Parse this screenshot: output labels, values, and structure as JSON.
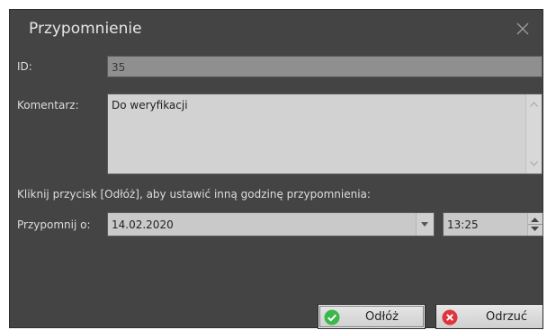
{
  "dialog": {
    "title": "Przypomnienie",
    "id_label": "ID:",
    "id_value": "35",
    "comment_label": "Komentarz:",
    "comment_value": "Do weryfikacji",
    "instruction": "Kliknij przycisk [Odłóż], aby ustawić inną godzinę przypomnienia:",
    "remind_label": "Przypomnij o:",
    "date_value": "14.02.2020",
    "time_value": "13:25",
    "postpone_label": "Odłóż",
    "reject_label": "Odrzuć"
  },
  "colors": {
    "background": "#444444",
    "field": "#c9c9c9",
    "ok_icon": "#3cb84a",
    "reject_icon": "#e0343b"
  },
  "icons": [
    "close-icon",
    "scroll-up-icon",
    "scroll-down-icon",
    "dropdown-arrow-icon",
    "spin-up-icon",
    "spin-down-icon",
    "check-circle-icon",
    "x-circle-icon"
  ]
}
